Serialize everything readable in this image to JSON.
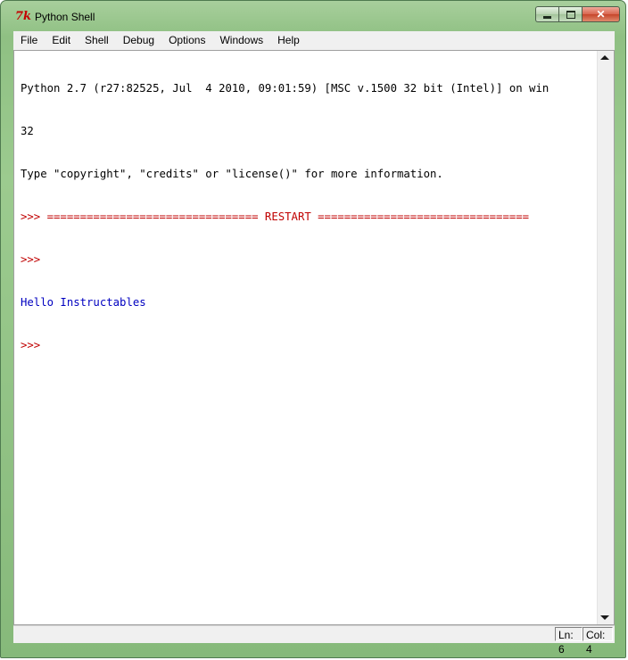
{
  "window": {
    "title": "Python Shell",
    "icon": "tk-icon",
    "controls": {
      "minimize": "minimize-icon",
      "maximize": "maximize-icon",
      "close": "✕"
    }
  },
  "menu": {
    "items": [
      "File",
      "Edit",
      "Shell",
      "Debug",
      "Options",
      "Windows",
      "Help"
    ]
  },
  "shell": {
    "lines": [
      {
        "text": "Python 2.7 (r27:82525, Jul  4 2010, 09:01:59) [MSC v.1500 32 bit (Intel)] on win",
        "style": "out"
      },
      {
        "text": "32",
        "style": "out"
      },
      {
        "text": "Type \"copyright\", \"credits\" or \"license()\" for more information.",
        "style": "out"
      },
      {
        "text": ">>> ================================ RESTART ================================",
        "style": "prompt"
      },
      {
        "text": ">>>",
        "style": "prompt"
      },
      {
        "text": "Hello Instructables",
        "style": "stdout"
      },
      {
        "text": ">>>",
        "style": "prompt"
      }
    ],
    "colors": {
      "output": "#000000",
      "prompt": "#c00000",
      "stdout": "#0000c0"
    }
  },
  "status": {
    "line": "Ln: 6",
    "column": "Col: 4"
  }
}
